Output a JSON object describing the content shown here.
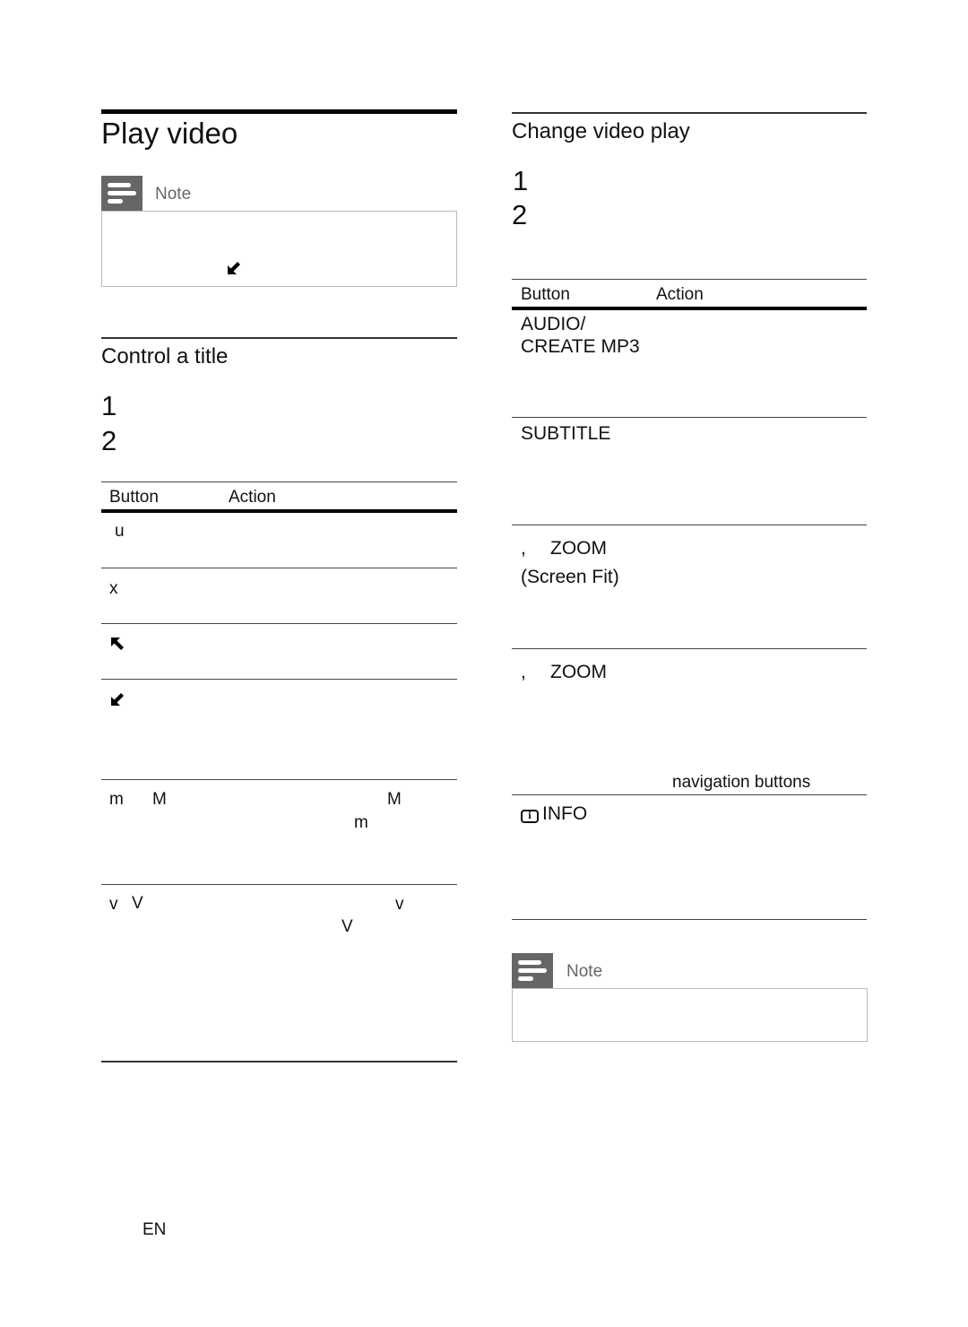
{
  "language_code": "EN",
  "left_column": {
    "play_video": {
      "title": "Play video",
      "note": {
        "label": "Note",
        "icon": "note-icon",
        "inline_icon": "back-arrow-icon"
      }
    },
    "control_title": {
      "title": "Control a title",
      "steps": [
        "1",
        "2"
      ],
      "table": {
        "headers": [
          "Button",
          "Action"
        ],
        "rows": [
          {
            "button": "u",
            "action_glyphs": []
          },
          {
            "button": "x",
            "action_glyphs": []
          },
          {
            "button_icon": "previous-arrow-icon",
            "action_glyphs": []
          },
          {
            "button_icon": "next-arrow-icon",
            "action_glyphs": []
          },
          {
            "button": "m",
            "button2": "M",
            "action_glyphs": [
              "M",
              "m"
            ]
          },
          {
            "button": "v",
            "button2": "V",
            "action_glyphs": [
              "v",
              "V"
            ]
          }
        ]
      }
    }
  },
  "right_column": {
    "change_video_play": {
      "title": "Change video play",
      "steps": [
        "1",
        "2"
      ],
      "table": {
        "headers": [
          "Button",
          "Action"
        ],
        "rows": [
          {
            "button_line1": "AUDIO/",
            "button_line2": "CREATE MP3"
          },
          {
            "button_line1": "SUBTITLE"
          },
          {
            "button_prefix": ",",
            "button_line1": "ZOOM",
            "button_line2": "(Screen Fit)"
          },
          {
            "button_prefix": ",",
            "button_line1": "ZOOM",
            "action_text": "navigation buttons"
          },
          {
            "button_icon": "info-icon",
            "button_line1": "INFO"
          }
        ]
      },
      "note": {
        "label": "Note",
        "icon": "note-icon"
      }
    }
  }
}
